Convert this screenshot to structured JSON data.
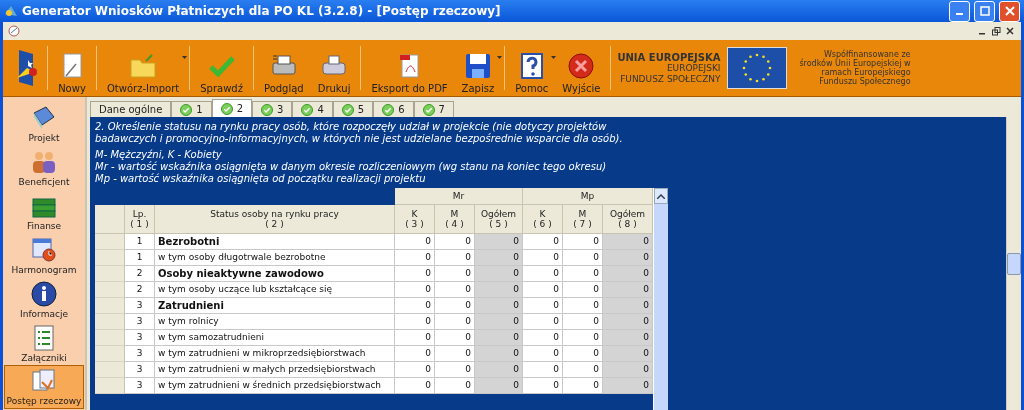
{
  "window": {
    "title": "Generator Wniosków Płatniczych dla PO KL (3.2.8) - [Postęp rzeczowy]"
  },
  "toolbar": [
    {
      "label": "Nowy",
      "has_menu": false
    },
    {
      "label": "Otwórz-Import",
      "has_menu": true
    },
    {
      "label": "Sprawdź",
      "has_menu": false
    },
    {
      "label": "Podgląd",
      "has_menu": false
    },
    {
      "label": "Drukuj",
      "has_menu": false
    },
    {
      "label": "Eksport do PDF",
      "has_menu": false
    },
    {
      "label": "Zapisz",
      "has_menu": true
    },
    {
      "label": "Pomoc",
      "has_menu": true
    },
    {
      "label": "Wyjście",
      "has_menu": false
    }
  ],
  "eu_logo": {
    "lines": [
      "UNIA EUROPEJSKA",
      "EUROPEJSKI",
      "FUNDUSZ SPOŁECZNY"
    ],
    "note": "Współfinansowane ze środków Unii Europejskiej w ramach Europejskiego Funduszu Społecznego"
  },
  "sidebar": {
    "items": [
      {
        "label": "Projekt",
        "selected": false
      },
      {
        "label": "Beneficjent",
        "selected": false
      },
      {
        "label": "Finanse",
        "selected": false
      },
      {
        "label": "Harmonogram",
        "selected": false
      },
      {
        "label": "Informacje",
        "selected": false
      },
      {
        "label": "Załączniki",
        "selected": false
      },
      {
        "label": "Postęp rzeczowy",
        "selected": true
      }
    ]
  },
  "tabs": [
    {
      "label": "Dane ogólne",
      "checked": false,
      "selected": false
    },
    {
      "label": "1",
      "checked": true,
      "selected": false
    },
    {
      "label": "2",
      "checked": true,
      "selected": true
    },
    {
      "label": "3",
      "checked": true,
      "selected": false
    },
    {
      "label": "4",
      "checked": true,
      "selected": false
    },
    {
      "label": "5",
      "checked": true,
      "selected": false
    },
    {
      "label": "6",
      "checked": true,
      "selected": false
    },
    {
      "label": "7",
      "checked": true,
      "selected": false
    }
  ],
  "description": [
    "2. Określenie statusu na rynku pracy osób, które rozpoczęły udział w projekcie (nie dotyczy projektów badawczych i promocyjno-informacyjnych, w których nie jest udzielane bezpośrednie wsparcie dla osób)."
  ],
  "legend": [
    "M- Mężczyźni, K - Kobiety",
    "Mr - wartość wskaźnika osiągnięta w danym okresie rozliczeniowym (wg stanu na koniec tego okresu)",
    "Mp - wartość wskaźnika osiągnięta od początku realizacji projektu"
  ],
  "table": {
    "groups": [
      "Mr",
      "Mp"
    ],
    "columns": [
      {
        "label": "Lp.",
        "number": "( 1 )",
        "kind": "lp"
      },
      {
        "label": "Status osoby na rynku pracy",
        "number": "( 2 )",
        "kind": "status"
      },
      {
        "label": "K",
        "number": "( 3 )",
        "kind": "input"
      },
      {
        "label": "M",
        "number": "( 4 )",
        "kind": "input"
      },
      {
        "label": "Ogółem",
        "number": "( 5 )",
        "kind": "total"
      },
      {
        "label": "K",
        "number": "( 6 )",
        "kind": "input"
      },
      {
        "label": "M",
        "number": "( 7 )",
        "kind": "input"
      },
      {
        "label": "Ogółem",
        "number": "( 8 )",
        "kind": "total"
      }
    ],
    "rows": [
      {
        "lp": "1",
        "status": "Bezrobotni",
        "kind": "group",
        "values": [
          "0",
          "0",
          "0",
          "0",
          "0",
          "0"
        ]
      },
      {
        "lp": "1",
        "status": "w tym osoby długotrwale bezrobotne",
        "kind": "sub",
        "values": [
          "0",
          "0",
          "0",
          "0",
          "0",
          "0"
        ]
      },
      {
        "lp": "2",
        "status": "Osoby nieaktywne zawodowo",
        "kind": "group",
        "values": [
          "0",
          "0",
          "0",
          "0",
          "0",
          "0"
        ]
      },
      {
        "lp": "2",
        "status": "w tym osoby uczące lub kształcące się",
        "kind": "sub",
        "values": [
          "0",
          "0",
          "0",
          "0",
          "0",
          "0"
        ]
      },
      {
        "lp": "3",
        "status": "Zatrudnieni",
        "kind": "group",
        "values": [
          "0",
          "0",
          "0",
          "0",
          "0",
          "0"
        ]
      },
      {
        "lp": "3",
        "status": "w tym rolnicy",
        "kind": "sub",
        "values": [
          "0",
          "0",
          "0",
          "0",
          "0",
          "0"
        ]
      },
      {
        "lp": "3",
        "status": "w tym samozatrudnieni",
        "kind": "sub",
        "values": [
          "0",
          "0",
          "0",
          "0",
          "0",
          "0"
        ]
      },
      {
        "lp": "3",
        "status": "w tym zatrudnieni w mikroprzedsiębiorstwach",
        "kind": "sub",
        "values": [
          "0",
          "0",
          "0",
          "0",
          "0",
          "0"
        ]
      },
      {
        "lp": "3",
        "status": "w tym zatrudnieni w małych przedsiębiorstwach",
        "kind": "sub",
        "values": [
          "0",
          "0",
          "0",
          "0",
          "0",
          "0"
        ]
      },
      {
        "lp": "3",
        "status": "w tym zatrudnieni w średnich przedsiębiorstwach",
        "kind": "sub",
        "values": [
          "0",
          "0",
          "0",
          "0",
          "0",
          "0"
        ]
      }
    ]
  }
}
